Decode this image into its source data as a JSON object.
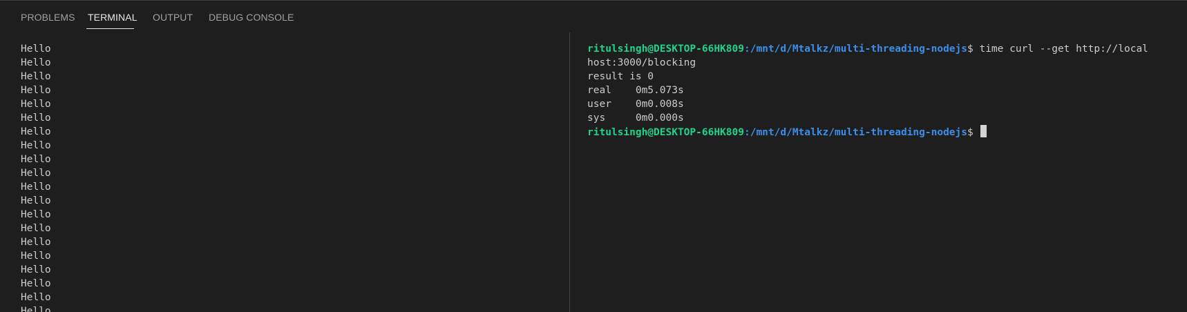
{
  "tabs": [
    {
      "label": "PROBLEMS",
      "active": false
    },
    {
      "label": "TERMINAL",
      "active": true
    },
    {
      "label": "OUTPUT",
      "active": false
    },
    {
      "label": "DEBUG CONSOLE",
      "active": false
    }
  ],
  "left_terminal": {
    "lines": [
      "Hello",
      "Hello",
      "Hello",
      "Hello",
      "Hello",
      "Hello",
      "Hello",
      "Hello",
      "Hello",
      "Hello",
      "Hello",
      "Hello",
      "Hello",
      "Hello",
      "Hello",
      "Hello",
      "Hello",
      "Hello",
      "Hello",
      "Hello"
    ]
  },
  "right_terminal": {
    "prompt1": {
      "user": "ritulsingh@DESKTOP-66HK809",
      "path": ":/mnt/d/Mtalkz/multi-threading-nodejs",
      "symbol": "$ ",
      "command": "time curl --get http://local"
    },
    "wrap_line": "host:3000/blocking",
    "result_line": "result is 0",
    "timing": [
      {
        "label": "real",
        "value": "0m5.073s"
      },
      {
        "label": "user",
        "value": "0m0.008s"
      },
      {
        "label": "sys",
        "value": "0m0.000s"
      }
    ],
    "prompt2": {
      "user": "ritulsingh@DESKTOP-66HK809",
      "path": ":/mnt/d/Mtalkz/multi-threading-nodejs",
      "symbol": "$ "
    }
  },
  "colors": {
    "background": "#1e1e1e",
    "prompt_user": "#23d18b",
    "prompt_path": "#3b8eea",
    "text": "#cccccc"
  }
}
